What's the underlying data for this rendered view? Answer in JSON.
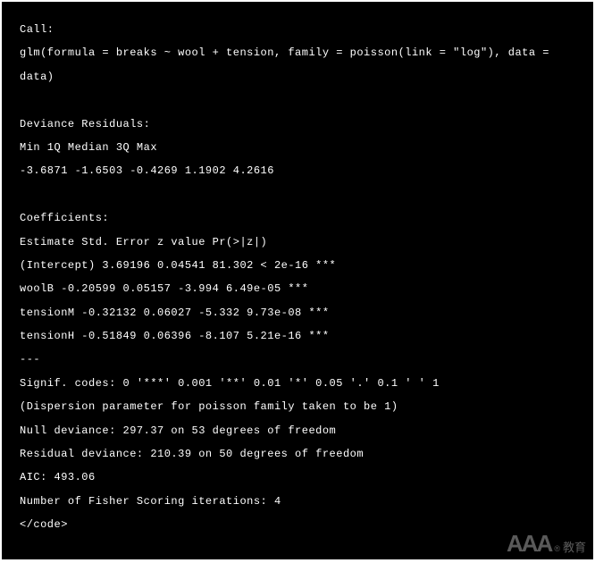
{
  "output": {
    "call_label": "Call:",
    "call_formula": "glm(formula = breaks ~ wool + tension, family = poisson(link = \"log\"), data = data)",
    "dev_res_label": "Deviance Residuals:",
    "dev_res_header": "Min 1Q Median 3Q Max",
    "dev_res_values": "-3.6871 -1.6503 -0.4269 1.1902 4.2616",
    "coef_label": "Coefficients:",
    "coef_header": "Estimate Std. Error z value Pr(>|z|)",
    "coef_intercept": "(Intercept) 3.69196 0.04541 81.302 < 2e-16 ***",
    "coef_woolB": "woolB -0.20599 0.05157 -3.994 6.49e-05 ***",
    "coef_tensionM": "tensionM -0.32132 0.06027 -5.332 9.73e-08 ***",
    "coef_tensionH": "tensionH -0.51849 0.06396 -8.107 5.21e-16 ***",
    "sep": "---",
    "signif_codes": "Signif. codes: 0 '***' 0.001 '**' 0.01 '*' 0.05 '.' 0.1 ' ' 1",
    "dispersion": "(Dispersion parameter for poisson family taken to be 1)",
    "null_dev": "Null deviance: 297.37 on 53 degrees of freedom",
    "resid_dev": "Residual deviance: 210.39 on 50 degrees of freedom",
    "aic": "AIC: 493.06",
    "fisher": "Number of Fisher Scoring iterations: 4",
    "end_tag": "</code>"
  },
  "watermark": {
    "main": "AAA",
    "reg": "®",
    "edu": "教育"
  }
}
